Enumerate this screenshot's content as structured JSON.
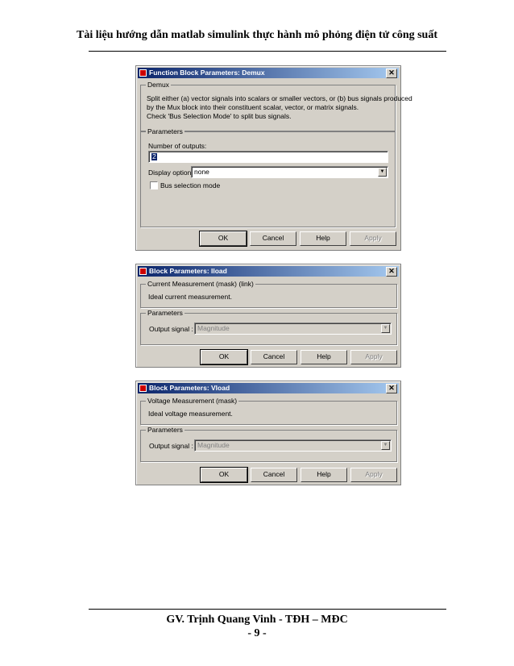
{
  "page": {
    "header": "Tài liệu hướng dẫn matlab simulink thực hành mô phỏng điện tử công suất",
    "footer_author": "GV. Trịnh Quang Vinh - TĐH – MĐC",
    "page_number": "- 9 -"
  },
  "demux": {
    "title": "Function Block Parameters: Demux",
    "group1": "Demux",
    "desc_lines": [
      "Split either (a) vector signals into scalars or smaller vectors, or (b) bus signals produced",
      "by the Mux block into their constituent scalar, vector, or matrix signals.",
      "Check 'Bus Selection Mode' to split bus signals."
    ],
    "group2": "Parameters",
    "outputs_label": "Number of outputs:",
    "outputs_value": "2",
    "display_label": "Display option:",
    "display_value": "none",
    "bus_label": "Bus selection mode",
    "buttons": {
      "ok": "OK",
      "cancel": "Cancel",
      "help": "Help",
      "apply": "Apply"
    }
  },
  "iload": {
    "title": "Block Parameters: Iload",
    "group1": "Current Measurement (mask) (link)",
    "desc": "Ideal current measurement.",
    "group2": "Parameters",
    "output_label": "Output signal :",
    "output_value": "Magnitude",
    "buttons": {
      "ok": "OK",
      "cancel": "Cancel",
      "help": "Help",
      "apply": "Apply"
    }
  },
  "vload": {
    "title": "Block Parameters: Vload",
    "group1": "Voltage Measurement (mask)",
    "desc": "Ideal voltage measurement.",
    "group2": "Parameters",
    "output_label": "Output signal :",
    "output_value": "Magnitude",
    "buttons": {
      "ok": "OK",
      "cancel": "Cancel",
      "help": "Help",
      "apply": "Apply"
    }
  },
  "icons": {
    "close": "close-icon",
    "app": "simulink-block-icon",
    "dropdown": "chevron-down-icon"
  }
}
